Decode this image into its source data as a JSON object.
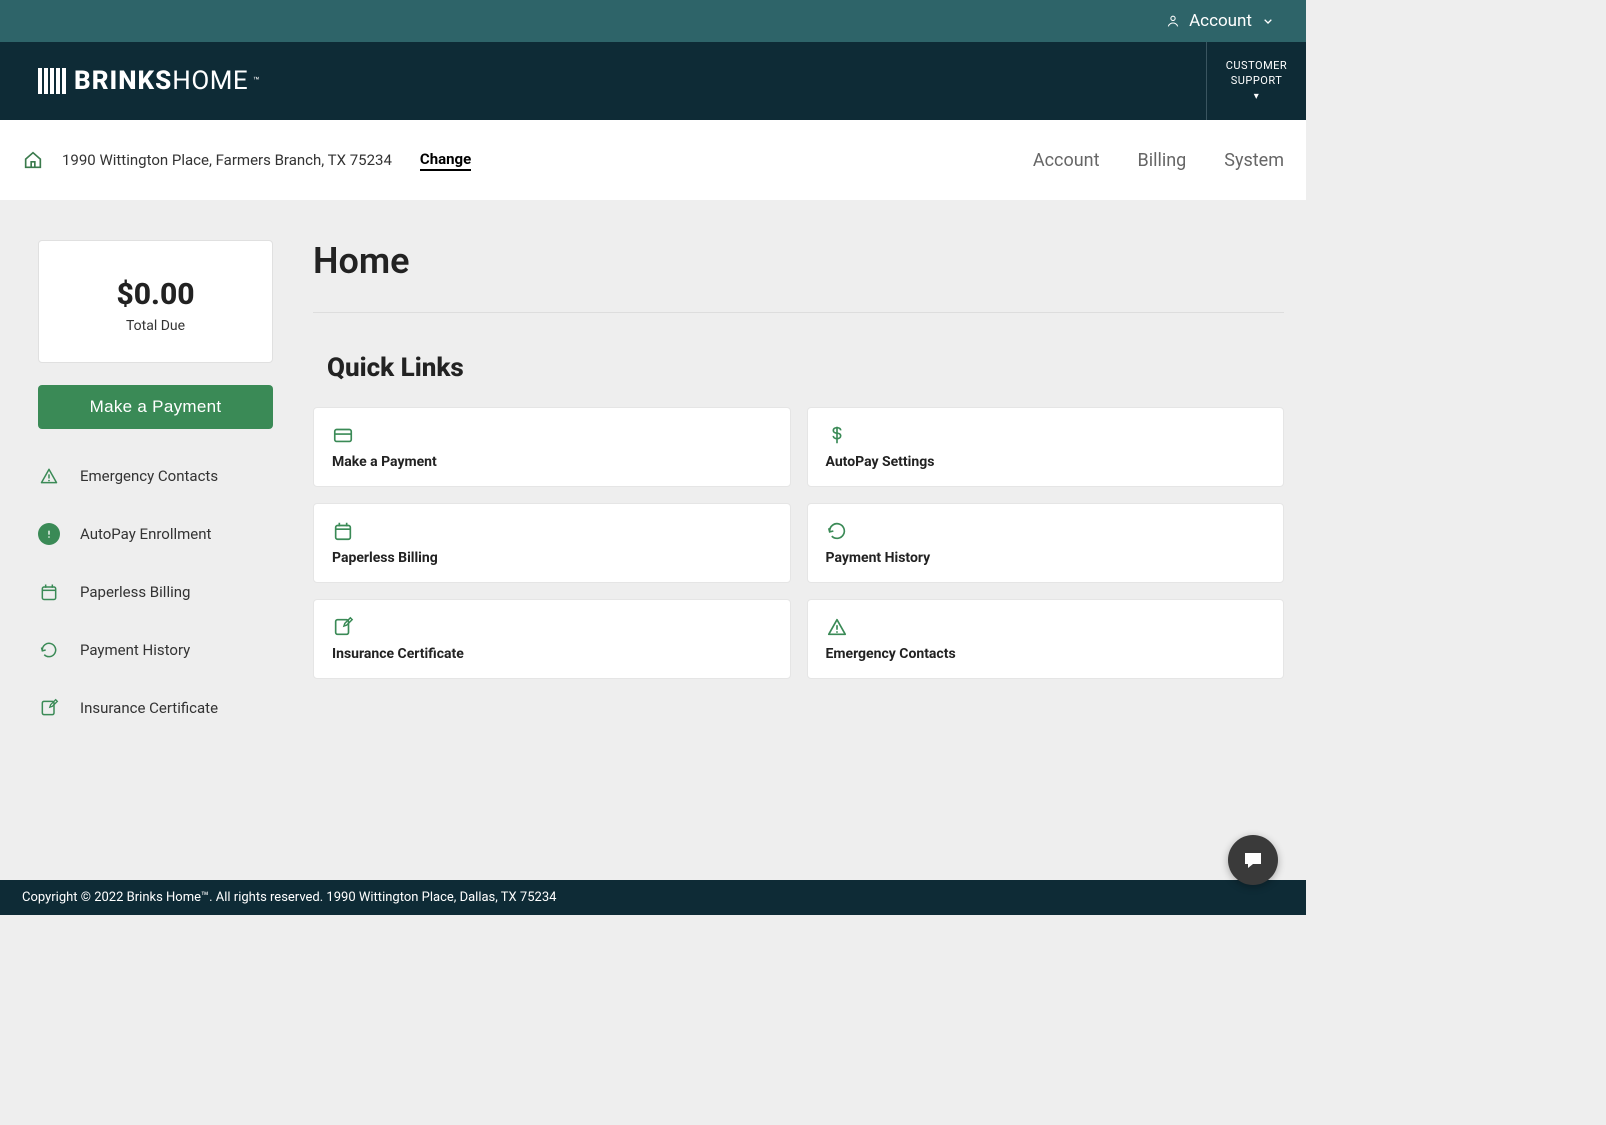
{
  "topbar": {
    "account_label": "Account"
  },
  "header": {
    "logo_bold": "BRINKS",
    "logo_light": "HOME",
    "logo_tm": "™",
    "support_line1": "CUSTOMER",
    "support_line2": "SUPPORT"
  },
  "subnav": {
    "address": "1990 Wittington Place, Farmers Branch, TX 75234",
    "change": "Change",
    "links": [
      "Account",
      "Billing",
      "System"
    ]
  },
  "sidebar": {
    "due_amount": "$0.00",
    "due_label": "Total Due",
    "pay_button": "Make a Payment",
    "links": [
      {
        "label": "Emergency Contacts",
        "icon": "triangle-alert",
        "filled": false
      },
      {
        "label": "AutoPay Enrollment",
        "icon": "exclaim",
        "filled": true
      },
      {
        "label": "Paperless Billing",
        "icon": "calendar",
        "filled": false
      },
      {
        "label": "Payment History",
        "icon": "history",
        "filled": false
      },
      {
        "label": "Insurance Certificate",
        "icon": "edit",
        "filled": false
      }
    ]
  },
  "content": {
    "page_title": "Home",
    "section_title": "Quick Links",
    "cards": [
      {
        "label": "Make a Payment",
        "icon": "card"
      },
      {
        "label": "AutoPay Settings",
        "icon": "dollar"
      },
      {
        "label": "Paperless Billing",
        "icon": "calendar"
      },
      {
        "label": "Payment History",
        "icon": "history"
      },
      {
        "label": "Insurance Certificate",
        "icon": "edit"
      },
      {
        "label": "Emergency Contacts",
        "icon": "triangle-alert"
      }
    ]
  },
  "footer": {
    "text": "Copyright © 2022 Brinks Home™. All rights reserved. 1990 Wittington Place, Dallas, TX 75234"
  }
}
